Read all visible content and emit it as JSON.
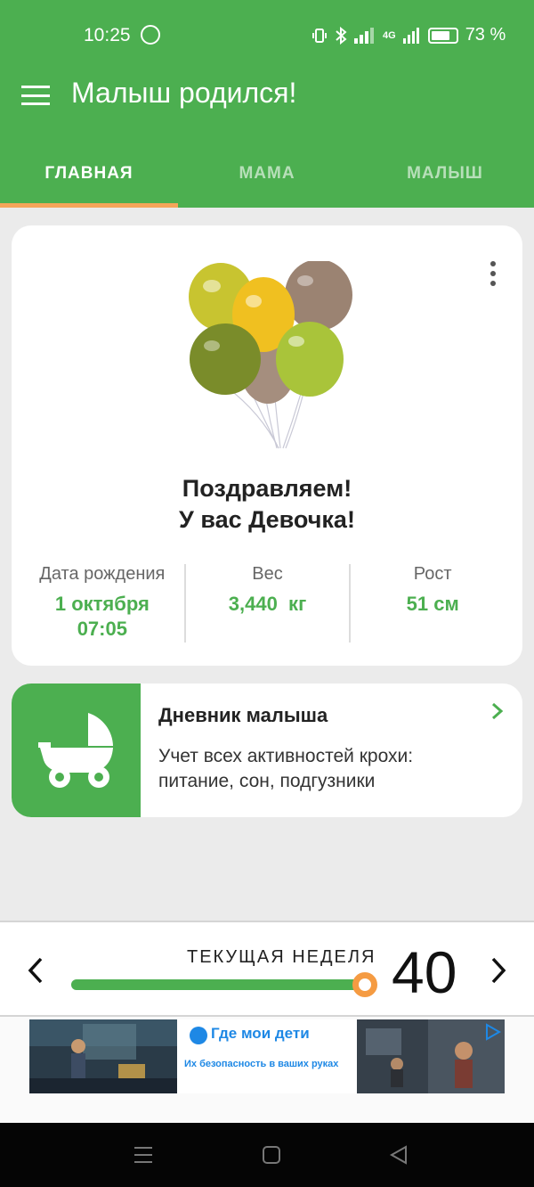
{
  "status_bar": {
    "time": "10:25",
    "battery_percent": "73 %",
    "signal_label": "4G"
  },
  "app_bar": {
    "title": "Малыш родился!"
  },
  "tabs": [
    {
      "label": "ГЛАВНАЯ",
      "active": true
    },
    {
      "label": "МАМА",
      "active": false
    },
    {
      "label": "МАЛЫШ",
      "active": false
    }
  ],
  "hero": {
    "congrats_line1": "Поздравляем!",
    "congrats_line2": "У вас Девочка!",
    "stats": [
      {
        "label": "Дата рождения",
        "value_line1": "1 октября",
        "value_line2": "07:05"
      },
      {
        "label": "Вес",
        "value_line1": "3,440  кг",
        "value_line2": ""
      },
      {
        "label": "Рост",
        "value_line1": "51 см",
        "value_line2": ""
      }
    ]
  },
  "diary": {
    "title": "Дневник малыша",
    "description": "Учет всех активностей крохи: питание, сон, подгузники"
  },
  "week": {
    "label": "ТЕКУЩАЯ НЕДЕЛЯ",
    "number": "40",
    "progress": 0.97
  },
  "ad": {
    "title": "Где мои дети",
    "subtitle": "Их безопасность в ваших руках"
  },
  "colors": {
    "primary": "#4caf50",
    "accent": "#f59b42",
    "tab_indicator": "#f5a55a"
  }
}
